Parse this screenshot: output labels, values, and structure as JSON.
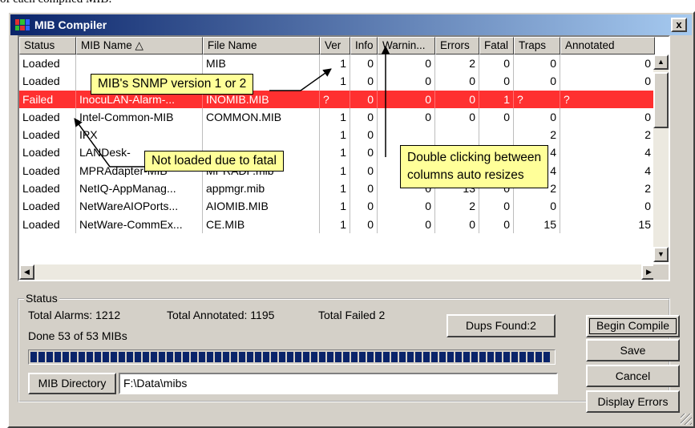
{
  "caption": "of each compiled MIB:",
  "window": {
    "title": "MIB Compiler",
    "close": "x"
  },
  "columns": [
    "Status",
    "MIB Name △",
    "File Name",
    "Ver",
    "Info",
    "Warnin...",
    "Errors",
    "Fatal",
    "Traps",
    "Annotated"
  ],
  "rows": [
    {
      "status": "Loaded",
      "name": "",
      "file": "MIB",
      "ver": "1",
      "info": "0",
      "warn": "0",
      "errors": "2",
      "fatal": "0",
      "traps": "0",
      "annot": "0"
    },
    {
      "status": "Loaded",
      "name": "",
      "file": "MIB",
      "ver": "1",
      "info": "0",
      "warn": "0",
      "errors": "0",
      "fatal": "0",
      "traps": "0",
      "annot": "0"
    },
    {
      "status": "Failed",
      "name": "InocuLAN-Alarm-...",
      "file": "INOMIB.MIB",
      "ver": "?",
      "info": "0",
      "warn": "0",
      "errors": "0",
      "fatal": "1",
      "traps": "?",
      "annot": "?",
      "failed": true
    },
    {
      "status": "Loaded",
      "name": "Intel-Common-MIB",
      "file": "COMMON.MIB",
      "ver": "1",
      "info": "0",
      "warn": "0",
      "errors": "0",
      "fatal": "0",
      "traps": "0",
      "annot": "0"
    },
    {
      "status": "Loaded",
      "name": "IPX",
      "file": "",
      "ver": "1",
      "info": "0",
      "warn": "",
      "errors": "",
      "fatal": "",
      "traps": "2",
      "annot": "2"
    },
    {
      "status": "Loaded",
      "name": "LANDesk-",
      "file": "",
      "ver": "1",
      "info": "0",
      "warn": "",
      "errors": "",
      "fatal": "",
      "traps": "4",
      "annot": "4"
    },
    {
      "status": "Loaded",
      "name": "MPRAdapter-MIB",
      "file": "MPRADP.mib",
      "ver": "1",
      "info": "0",
      "warn": "",
      "errors": "",
      "fatal": "",
      "traps": "4",
      "annot": "4"
    },
    {
      "status": "Loaded",
      "name": "NetIQ-AppManag...",
      "file": "appmgr.mib",
      "ver": "1",
      "info": "0",
      "warn": "0",
      "errors": "13",
      "fatal": "0",
      "traps": "2",
      "annot": "2"
    },
    {
      "status": "Loaded",
      "name": "NetWareAIOPorts...",
      "file": "AIOMIB.MIB",
      "ver": "1",
      "info": "0",
      "warn": "0",
      "errors": "2",
      "fatal": "0",
      "traps": "0",
      "annot": "0"
    },
    {
      "status": "Loaded",
      "name": "NetWare-CommEx...",
      "file": "CE.MIB",
      "ver": "1",
      "info": "0",
      "warn": "0",
      "errors": "0",
      "fatal": "0",
      "traps": "15",
      "annot": "15"
    }
  ],
  "callouts": {
    "snmp": "MIB's SNMP version 1 or 2",
    "fatal": "Not loaded due to fatal",
    "resize_1": "Double clicking between",
    "resize_2": "columns auto resizes"
  },
  "status": {
    "group_label": "Status",
    "total_alarms": "Total Alarms:  1212",
    "total_annotated": "Total Annotated:  1195",
    "total_failed": "Total Failed   2",
    "dups": "Dups Found:2",
    "done": "Done 53 of 53 MIBs",
    "progress_fraction": 1.0,
    "mib_dir_button": "MIB Directory",
    "mib_dir_value": "F:\\Data\\mibs"
  },
  "buttons": {
    "begin": "Begin Compile",
    "save": "Save",
    "cancel": "Cancel",
    "display_errors": "Display Errors"
  },
  "scroll": {
    "up": "▲",
    "down": "▼",
    "left": "◀",
    "right": "▶"
  },
  "colors": {
    "titlebar": "#0a246a",
    "failed_row": "#ff3030",
    "callout": "#ffff99",
    "progress": "#0a246a"
  }
}
